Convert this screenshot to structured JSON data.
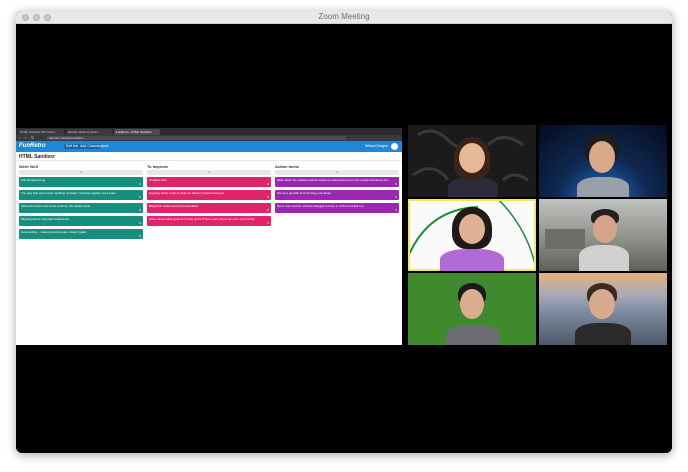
{
  "window": {
    "title": "Zoom Meeting"
  },
  "browser": {
    "tabs": [
      "HTML Sanitizer API Cover...",
      "Weekly Meeting Notes...",
      "FunRetro - HTML Sanitizer"
    ],
    "url": "funretro.io/board/xJzA6r9..."
  },
  "app": {
    "logo": "FunRetro",
    "pills": [
      "Edit Info",
      "Add Column",
      "Layout"
    ],
    "right_text": "Wilson Dragon"
  },
  "board": {
    "title": "HTML Sanitizer",
    "columns": [
      {
        "name": "Went Well",
        "color": "#168f7f",
        "cards": [
          {
            "text": "Pair Programming",
            "votes": "0"
          },
          {
            "text": "The way that we've been splitting up tasks / working together as a team",
            "votes": "0"
          },
          {
            "text": "Setup the fixture test & the readme, the design tests",
            "votes": "0"
          },
          {
            "text": "Meeting all the important milestones",
            "votes": "0"
          },
          {
            "text": "Goal setting – made granular goals, stretch goals",
            "votes": "0"
          }
        ]
      },
      {
        "name": "To Improve",
        "color": "#e0246b",
        "cards": [
          {
            "text": "Creative PRs",
            "votes": "0"
          },
          {
            "text": "Keeping better track of what we haven't implemented yet",
            "votes": "0"
          },
          {
            "text": "Blog/Tech writers and documentation",
            "votes": "0"
          },
          {
            "text": "Have measurable goals for 9 day sprint (There were points we were a bit stuck)",
            "votes": "0"
          }
        ]
      },
      {
        "name": "Action Items",
        "color": "#9b27b0",
        "cards": [
          {
            "text": "Write down the classes that we haven't implemented yet in the design decisions doc",
            "votes": "0"
          },
          {
            "text": "Set up a specific time for blog post tasks",
            "votes": "0"
          },
          {
            "text": "Set a max number of lines changed to have in a PR and stick to it",
            "votes": "0"
          }
        ]
      }
    ]
  },
  "participants": [
    {
      "position": "top-left",
      "background": "#1b1b1b",
      "shirt": "#2b2b3a",
      "hair": "#3a2418",
      "skin": "#e6b89a"
    },
    {
      "position": "top-right",
      "background": "#0f2a55",
      "shirt": "#9aa0a8",
      "hair": "#1d1d1d",
      "skin": "#d9a98a"
    },
    {
      "position": "middle-left",
      "background": "#fafafa",
      "shirt": "#b26bd6",
      "hair": "#1e1a18",
      "skin": "#e2b094",
      "speaking": true
    },
    {
      "position": "middle-right",
      "background": "#8a8d86",
      "shirt": "#d0d0d0",
      "hair": "#222222",
      "skin": "#d6a487"
    },
    {
      "position": "bottom-left",
      "background": "#3f8a2c",
      "shirt": "#6b6b72",
      "hair": "#1a1a1a",
      "skin": "#d9ae90"
    },
    {
      "position": "bottom-right",
      "background": "#7c8aa0",
      "shirt": "#2a2a2a",
      "hair": "#3a2a22",
      "skin": "#d9ab8e"
    }
  ]
}
